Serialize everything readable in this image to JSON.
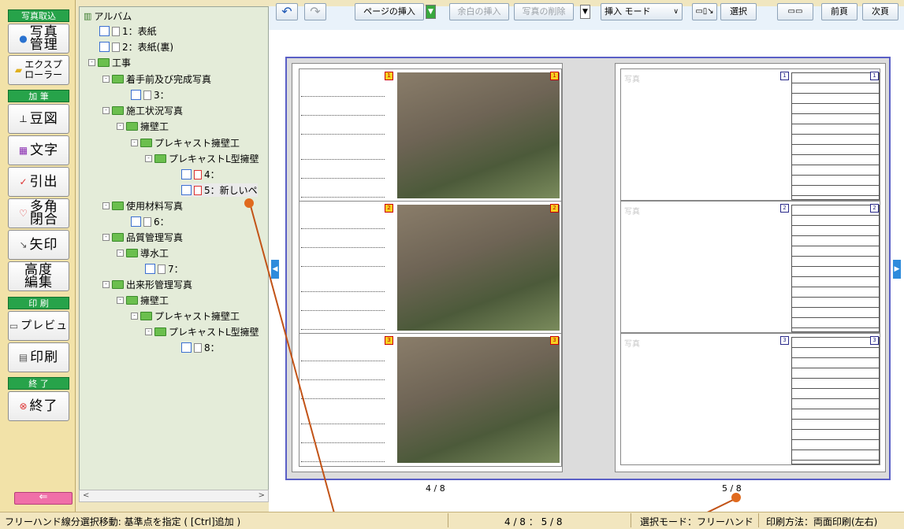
{
  "left_panel": {
    "group_photo": "写真取込",
    "btn_photo_manage": "写真\n管理",
    "btn_explorer": "エクスプ\nローラー",
    "group_edit": "加 筆",
    "btn_zu": "豆図",
    "btn_moji": "文字",
    "btn_hiki": "引出",
    "btn_takaku": "多角\n閉合",
    "btn_yajirushi": "矢印",
    "btn_kodo": "高度\n編集",
    "group_print": "印 刷",
    "btn_preview": "プレビュ",
    "btn_print": "印刷",
    "group_end": "終 了",
    "btn_end": "終了",
    "back_arrow": "⇐"
  },
  "tree": {
    "root": "アルバム",
    "items": [
      {
        "label": "1：表紙"
      },
      {
        "label": "2：表紙(裏)"
      },
      {
        "label": "工事"
      },
      {
        "label": "着手前及び完成写真"
      },
      {
        "label": "3："
      },
      {
        "label": "施工状況写真"
      },
      {
        "label": "擁壁工"
      },
      {
        "label": "プレキャスト擁壁工"
      },
      {
        "label": "プレキャストL型擁壁"
      },
      {
        "label": "4："
      },
      {
        "label": "5：新しいペ"
      },
      {
        "label": "使用材料写真"
      },
      {
        "label": "6："
      },
      {
        "label": "品質管理写真"
      },
      {
        "label": "導水工"
      },
      {
        "label": "7："
      },
      {
        "label": "出来形管理写真"
      },
      {
        "label": "擁壁工"
      },
      {
        "label": "プレキャスト擁壁工"
      },
      {
        "label": "プレキャストL型擁壁"
      },
      {
        "label": "8："
      }
    ]
  },
  "toolbar": {
    "undo": "↶",
    "redo": "↷",
    "insert_page": "ページの挿入",
    "insert_margin": "余白の挿入",
    "delete_photo": "写真の削除",
    "insert_mode": "挿入 モード",
    "select": "選択",
    "prev": "前頁",
    "next": "次頁"
  },
  "pages": {
    "left_number": "4 / 8",
    "right_number": "5 / 8",
    "photo_placeholder": "写真",
    "slot_numbers": [
      "1",
      "2",
      "3"
    ]
  },
  "status": {
    "hint": "フリーハンド線分選択移動: 基準点を指定 ( [Ctrl]追加 )",
    "pages": "4 / 8 ： 5 / 8",
    "select_mode": "選択モード：フリーハンド",
    "print_mode": "印刷方法：両面印刷(左右)"
  },
  "colors": {
    "accent_green": "#27a34a",
    "book_border": "#5a5fc6",
    "callout": "#c25317"
  }
}
